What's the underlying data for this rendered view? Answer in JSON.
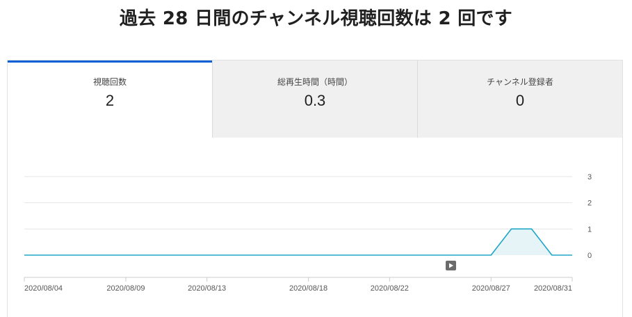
{
  "page": {
    "title": "過去 28 日間のチャンネル視聴回数は 2 回です"
  },
  "tabs": [
    {
      "label": "視聴回数",
      "value": "2",
      "active": true
    },
    {
      "label": "総再生時間（時間）",
      "value": "0.3",
      "active": false
    },
    {
      "label": "チャンネル登録者",
      "value": "0",
      "active": false
    }
  ],
  "colors": {
    "accent": "#065fd4",
    "line": "#1ea7c5",
    "fill": "#e6f4f8",
    "grid": "#e5e5e5"
  },
  "chart_data": {
    "type": "area",
    "xlabel": "",
    "ylabel": "",
    "ylim": [
      0,
      3
    ],
    "yticks": [
      0,
      1,
      2,
      3
    ],
    "x_tick_labels": [
      "2020/08/04",
      "2020/08/09",
      "2020/08/13",
      "2020/08/18",
      "2020/08/22",
      "2020/08/27",
      "2020/08/31"
    ],
    "x_start": "2020/08/04",
    "x_end": "2020/08/31",
    "grid": true,
    "series": [
      {
        "name": "",
        "points": [
          {
            "x": "2020/08/04",
            "y": 0
          },
          {
            "x": "2020/08/27",
            "y": 0
          },
          {
            "x": "2020/08/28",
            "y": 1
          },
          {
            "x": "2020/08/29",
            "y": 1
          },
          {
            "x": "2020/08/30",
            "y": 0
          },
          {
            "x": "2020/08/31",
            "y": 0
          }
        ]
      }
    ]
  },
  "annotation_icon": "video-play-icon"
}
